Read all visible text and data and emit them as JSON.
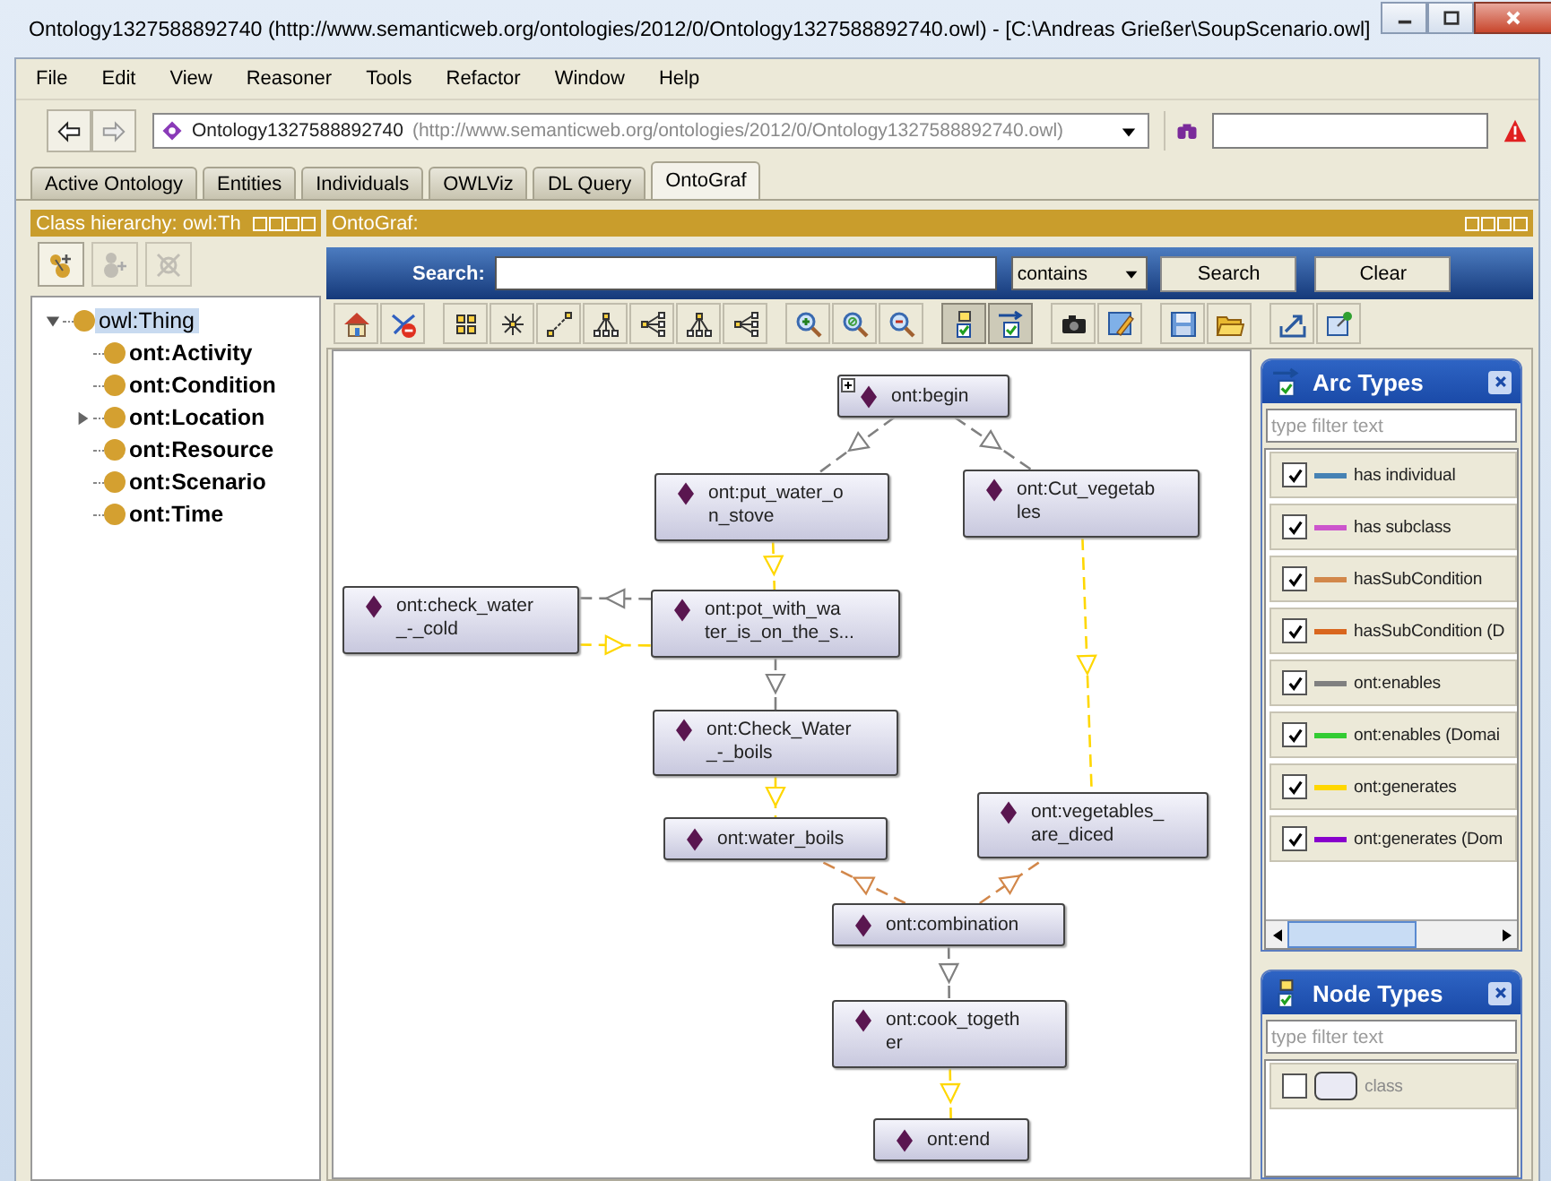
{
  "window": {
    "title": "Ontology1327588892740 (http://www.semanticweb.org/ontologies/2012/0/Ontology1327588892740.owl) - [C:\\Andreas Grießer\\SoupScenario.owl]"
  },
  "menu": [
    "File",
    "Edit",
    "View",
    "Reasoner",
    "Tools",
    "Refactor",
    "Window",
    "Help"
  ],
  "navigation": {
    "back_disabled": false,
    "forward_disabled": true,
    "ontology_name": "Ontology1327588892740",
    "ontology_iri": "(http://www.semanticweb.org/ontologies/2012/0/Ontology1327588892740.owl)"
  },
  "tabs": [
    {
      "label": "Active Ontology",
      "selected": false
    },
    {
      "label": "Entities",
      "selected": false
    },
    {
      "label": "Individuals",
      "selected": false
    },
    {
      "label": "OWLViz",
      "selected": false
    },
    {
      "label": "DL Query",
      "selected": false
    },
    {
      "label": "OntoGraf",
      "selected": true
    }
  ],
  "class_hierarchy": {
    "title": "Class hierarchy: owl:Th",
    "tools": [
      {
        "disabled": false
      },
      {
        "disabled": true
      },
      {
        "disabled": true
      }
    ],
    "tree": [
      {
        "label": "owl:Thing",
        "selected": true,
        "expanded": true,
        "children": [
          {
            "label": "ont:Activity",
            "selected": false,
            "expandable": false
          },
          {
            "label": "ont:Condition",
            "selected": false,
            "expandable": false
          },
          {
            "label": "ont:Location",
            "selected": false,
            "expandable": true
          },
          {
            "label": "ont:Resource",
            "selected": false,
            "expandable": false
          },
          {
            "label": "ont:Scenario",
            "selected": false,
            "expandable": false
          },
          {
            "label": "ont:Time",
            "selected": false,
            "expandable": false
          }
        ]
      }
    ]
  },
  "ontograf": {
    "title": "OntoGraf:",
    "search": {
      "label": "Search:",
      "mode": "contains",
      "buttons": [
        "Search",
        "Clear"
      ]
    },
    "toolbar": [
      {
        "pressed": false
      },
      {
        "pressed": false
      },
      {
        "pressed": false
      },
      {
        "pressed": false
      },
      {
        "pressed": false
      },
      {
        "pressed": false
      },
      {
        "pressed": false
      },
      {
        "pressed": false
      },
      {
        "pressed": false
      },
      {
        "pressed": false
      },
      {
        "pressed": false
      },
      {
        "pressed": false
      },
      {
        "pressed": true
      },
      {
        "pressed": true
      },
      {
        "pressed": false
      },
      {
        "pressed": false
      },
      {
        "pressed": false
      },
      {
        "pressed": false
      },
      {
        "pressed": false
      },
      {
        "pressed": false
      }
    ],
    "nodes": [
      {
        "lines": [
          "ont:begin"
        ],
        "expandable": true
      },
      {
        "lines": [
          "ont:put_water_o",
          "n_stove"
        ],
        "expandable": false
      },
      {
        "lines": [
          "ont:Cut_vegetab",
          "les"
        ],
        "expandable": false
      },
      {
        "lines": [
          "ont:check_water",
          "_-_cold"
        ],
        "expandable": false
      },
      {
        "lines": [
          "ont:pot_with_wa",
          "ter_is_on_the_s..."
        ],
        "expandable": false
      },
      {
        "lines": [
          "ont:Check_Water",
          "_-_boils"
        ],
        "expandable": false
      },
      {
        "lines": [
          "ont:water_boils"
        ],
        "expandable": false
      },
      {
        "lines": [
          "ont:vegetables_",
          "are_diced"
        ],
        "expandable": false
      },
      {
        "lines": [
          "ont:combination"
        ],
        "expandable": false
      },
      {
        "lines": [
          "ont:cook_togeth",
          "er"
        ],
        "expandable": false
      },
      {
        "lines": [
          "ont:end"
        ],
        "expandable": false
      }
    ],
    "arc_types": {
      "title": "Arc Types",
      "placeholder": "type filter text",
      "items": [
        {
          "label": "has individual",
          "checked": true,
          "color": "#4682b4"
        },
        {
          "label": "has subclass",
          "checked": true,
          "color": "#cc55cc"
        },
        {
          "label": "hasSubCondition",
          "checked": true,
          "color": "#d2874a"
        },
        {
          "label": "hasSubCondition (D",
          "checked": true,
          "color": "#d9661e"
        },
        {
          "label": "ont:enables",
          "checked": true,
          "color": "#808080"
        },
        {
          "label": "ont:enables (Domai",
          "checked": true,
          "color": "#33cc33"
        },
        {
          "label": "ont:generates",
          "checked": true,
          "color": "#ffd700"
        },
        {
          "label": "ont:generates (Dom",
          "checked": true,
          "color": "#8800cc"
        }
      ]
    },
    "node_types": {
      "title": "Node Types",
      "placeholder": "type filter text",
      "items": [
        {
          "label": "class",
          "checked": false
        }
      ]
    }
  }
}
